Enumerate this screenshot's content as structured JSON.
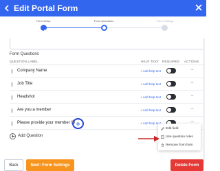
{
  "header": {
    "title": "Edit Portal Form",
    "bg_color": "#3366ee"
  },
  "steps": [
    {
      "label": "Form Setup",
      "state": "done"
    },
    {
      "label": "Form Questions",
      "state": "active"
    },
    {
      "label": "Form Settings",
      "state": "todo"
    }
  ],
  "section": {
    "title": "Form Questions",
    "columns": {
      "label": "QUESTION LABEL",
      "help": "HELP TEXT",
      "required": "REQUIRED",
      "actions": "ACTIONS"
    }
  },
  "questions": [
    {
      "label": "Company Name",
      "help": "+ Add help text",
      "required": true
    },
    {
      "label": "Job Title",
      "help": "+ Add help text",
      "required": true
    },
    {
      "label": "Headshot",
      "help": "+ Add help text",
      "required": true
    },
    {
      "label": "Are you a member",
      "help": "+ Add help text",
      "required": true
    },
    {
      "label": "Please provide your member ID",
      "help": "+ Add help text",
      "required": true
    }
  ],
  "actions_icon": "more-horizontal-icon",
  "add_question": "Add Question",
  "menu": {
    "items": [
      {
        "label": "Edit field",
        "icon": "pencil-icon"
      },
      {
        "label": "Use question rules",
        "icon": "rules-icon"
      },
      {
        "label": "Remove from form",
        "icon": "trash-icon"
      }
    ]
  },
  "footer": {
    "back": "Back",
    "next": "Next: Form Settings",
    "delete": "Delete Form"
  },
  "colors": {
    "primary": "#3366ee",
    "accent_orange": "#f7941d",
    "danger": "#e53935",
    "annotation_red": "#c62828"
  }
}
